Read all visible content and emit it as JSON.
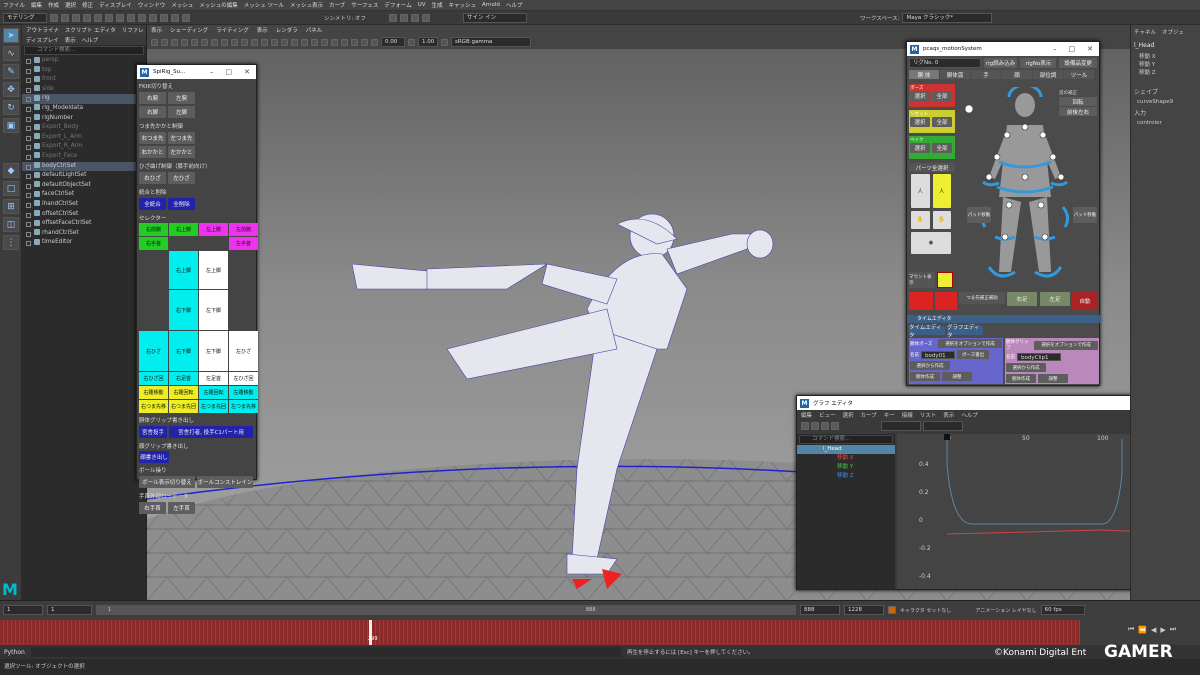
{
  "menubar": [
    "ファイル",
    "編集",
    "作成",
    "選択",
    "修正",
    "ディスプレイ",
    "ウィンドウ",
    "メッシュ",
    "メッシュの編集",
    "メッシュ ツール",
    "メッシュ表示",
    "カーブ",
    "サーフェス",
    "デフォーム",
    "UV",
    "生成",
    "キャッシュ",
    "Arnold",
    "ヘルプ"
  ],
  "status": {
    "mode": "モデリング",
    "symmetry": "シンメトリ: オフ",
    "signin": "サイン イン",
    "workspace_label": "ワークスペース:",
    "workspace": "Maya クラシック*"
  },
  "outliner": {
    "tabs": [
      "アウトライナ",
      "スクリプト エディタ",
      "リファレ"
    ],
    "menu": [
      "ディスプレイ",
      "表示",
      "ヘルプ"
    ],
    "search": "コマンド検索...",
    "items": [
      {
        "t": "persp",
        "d": true
      },
      {
        "t": "top",
        "d": true
      },
      {
        "t": "front",
        "d": true
      },
      {
        "t": "side",
        "d": true
      },
      {
        "t": "rig",
        "h": true
      },
      {
        "t": "rig_Modeldata"
      },
      {
        "t": "rigNumber"
      },
      {
        "t": "Export_Body",
        "d": true
      },
      {
        "t": "Export_L_Arm",
        "d": true
      },
      {
        "t": "Export_R_Arm",
        "d": true
      },
      {
        "t": "Export_Face",
        "d": true
      },
      {
        "t": "bodyCtrlSet",
        "h": true
      },
      {
        "t": "defaultLightSet"
      },
      {
        "t": "defaultObjectSet"
      },
      {
        "t": "faceCtrlSet"
      },
      {
        "t": "lhandCtrlSet"
      },
      {
        "t": "offsetCtrlSet"
      },
      {
        "t": "offsetFaceCtrlSet"
      },
      {
        "t": "rhandCtrlSet"
      },
      {
        "t": "timeEditor"
      }
    ]
  },
  "viewport": {
    "menu": [
      "表示",
      "シェーディング",
      "ライティング",
      "表示",
      "レンダラ",
      "パネル"
    ],
    "exposure": "0.00",
    "gamma": "1.00",
    "colorspace": "sRGB gamma",
    "camera": "persp"
  },
  "rigwin": {
    "title": "SpiRig_Su...",
    "sections": [
      {
        "h": "FKIK切り替え",
        "b": [
          [
            "右腕",
            "左腕"
          ],
          [
            "右脚",
            "左脚"
          ]
        ]
      },
      {
        "h": "つま先かかと制御",
        "b": [
          [
            "右つま先",
            "左つま先"
          ],
          [
            "右かかと",
            "左かかと"
          ]
        ]
      },
      {
        "h": "ひざ曲げ制御（膝手前向け）",
        "b": [
          [
            "右ひざ",
            "左ひざ"
          ]
        ]
      },
      {
        "h": "統合と削除",
        "b": [
          [
            "全統合",
            "全削除"
          ]
        ]
      }
    ],
    "selector": "セレクター",
    "grid": [
      [
        "右前腕",
        "右上腕",
        "左上腕",
        "左前腕"
      ],
      [
        "右手首",
        "",
        "",
        "左手首"
      ]
    ],
    "body": [
      [
        "右上脚",
        "左上脚"
      ],
      [
        "右下脚",
        "左下脚"
      ]
    ],
    "knees": [
      "右ひざ",
      "右下脚",
      "左下脚",
      "左ひざ"
    ],
    "knees2": [
      "右ひざ回",
      "右足首",
      "左足首",
      "左ひざ回"
    ],
    "moves": [
      [
        "右踵移動",
        "右踵回転",
        "左踵回転",
        "左踵移動"
      ],
      [
        "右つま先移",
        "右つま先回",
        "左つま先回",
        "左つま先移"
      ]
    ],
    "s2": "胴体グリップ書き出し",
    "b2": [
      "宮舎投手",
      "宮舎打者, 投手C1パート用"
    ],
    "s3": "顔グリップ書き出し",
    "b3": "顔書き出し",
    "s4": "ボール操り",
    "b4": [
      "ボール表示切り替え",
      "ボールコンストレイン"
    ],
    "s5": "手首外部ローテータ",
    "b5": [
      "右手首",
      "左手首"
    ]
  },
  "motion": {
    "title": "pcaqs_motionSystem",
    "rigno": "リグNo.  0",
    "load": "rig読み込み",
    "show": "rigNo表示",
    "save": "設備品変更",
    "tabs": [
      "胴 体",
      "胴体弧",
      "手",
      "顔",
      "部位調",
      "ツール"
    ],
    "groups": [
      {
        "h": "ポーズ",
        "c": "#c33"
      },
      {
        "h": "リセット",
        "c": "#cc3"
      },
      {
        "h": "ベイク",
        "c": "#3a3"
      }
    ],
    "sel": "選択",
    "all": "全部",
    "parts": "パーツ全選択",
    "head": "首の補正",
    "rot": "回転",
    "fb": "前後左右",
    "pad": "パッド移動",
    "mount": "マウント表示",
    "right": "右足",
    "left": "左足",
    "auto": "自動",
    "foot": "つま先補正補助",
    "timeedit": "タイムエディタ",
    "te": [
      "タイムエディタ",
      "グラフエディタ"
    ],
    "pose": "胴体ポーズ",
    "grip": "胴体グリップ",
    "optnew": "選択をオプションで作成",
    "name": "名前",
    "n1": "body01",
    "n2": "bodyClip1",
    "export": "ポーズ書出",
    "fromsel": "選択から作成",
    "create": "胴体作成",
    "adjust": "調整"
  },
  "graph": {
    "title": "グラフ エディタ",
    "menu": [
      "編集",
      "ビュー",
      "選択",
      "カーブ",
      "キー",
      "接線",
      "リスト",
      "表示",
      "ヘルプ"
    ],
    "search": "コマンド検索...",
    "node": "l_Head",
    "ch": [
      "移動 X",
      "移動 Y",
      "移動 Z"
    ],
    "xticks": [
      "0",
      "50",
      "100",
      "150"
    ],
    "yticks": [
      "0.4",
      "0.2",
      "0",
      "-0.2",
      "-0.4"
    ]
  },
  "attr": {
    "tabs": [
      "チャネル",
      "オブジェ"
    ],
    "node": "l_Head",
    "ch": [
      "移動 X",
      "移動 Y",
      "移動 Z"
    ],
    "shape": "シェイプ",
    "shapen": "curveShape9",
    "input": "入力",
    "inputn": "controler"
  },
  "time": {
    "start": "1",
    "cur": "1",
    "end": "888",
    "end2": "888",
    "end3": "1228",
    "frame": "299",
    "char": "キャラクタ セットなし",
    "anim": "アニメーション レイヤなし",
    "fps": "60 fps"
  },
  "cmd": {
    "py": "Python",
    "msg": "再生を停止するには [Esc] キーを押してください。",
    "help": "選択ツール: オブジェクトの選択",
    "copy": "©Konami Digital Ent",
    "gamer": "GAMER"
  }
}
